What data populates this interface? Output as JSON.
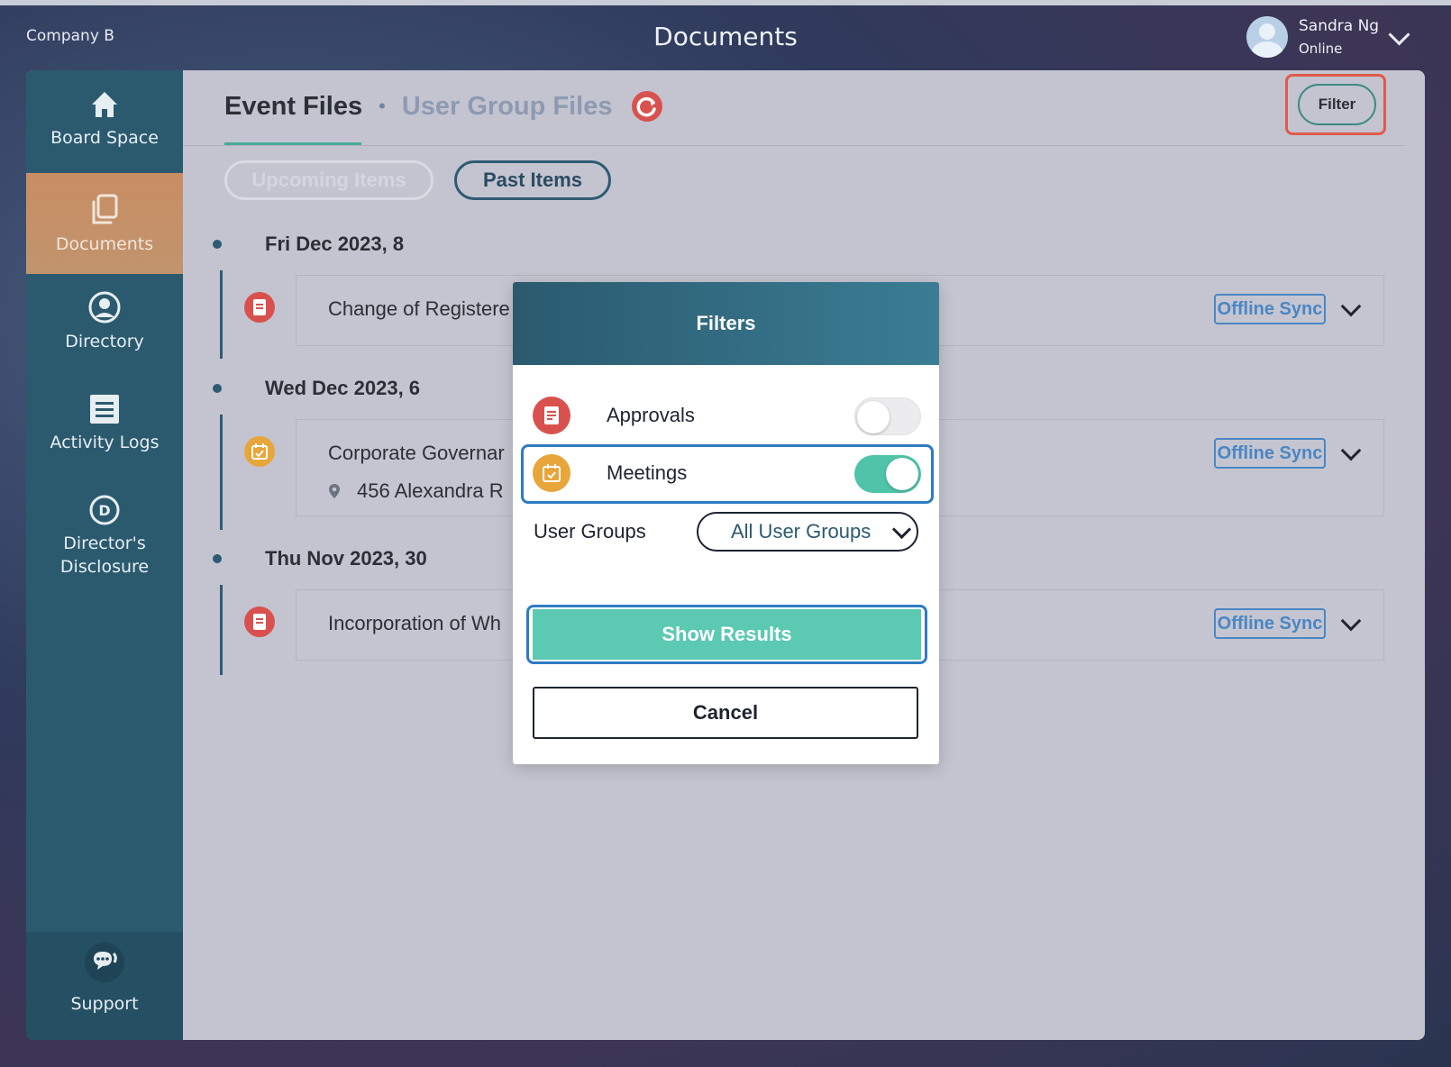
{
  "header": {
    "company": "Company B",
    "title": "Documents",
    "user_name": "Sandra Ng",
    "user_status": "Online"
  },
  "sidebar": {
    "items": [
      {
        "label": "Board Space",
        "icon": "home-icon"
      },
      {
        "label": "Documents",
        "icon": "documents-icon",
        "active": true
      },
      {
        "label": "Directory",
        "icon": "user-circle-icon"
      },
      {
        "label": "Activity Logs",
        "icon": "list-icon"
      },
      {
        "label": "Director's",
        "label2": "Disclosure",
        "icon": "d-circle-icon"
      }
    ],
    "support_label": "Support"
  },
  "tabs": {
    "active": "Event Files",
    "separator": "•",
    "inactive": "User Group Files"
  },
  "toolbar": {
    "filter_label": "Filter",
    "upcoming_label": "Upcoming Items",
    "past_label": "Past Items"
  },
  "events": [
    {
      "date": "Fri Dec 2023, 8",
      "title": "Change of Registere",
      "location": "",
      "type": "approval",
      "sync_label": "Offline Sync"
    },
    {
      "date": "Wed Dec 2023, 6",
      "title": "Corporate Governar",
      "location": "456 Alexandra R",
      "type": "meeting",
      "sync_label": "Offline Sync"
    },
    {
      "date": "Thu Nov 2023, 30",
      "title": "Incorporation of Wh",
      "location": "",
      "type": "approval",
      "sync_label": "Offline Sync"
    }
  ],
  "modal": {
    "title": "Filters",
    "approvals_label": "Approvals",
    "approvals_on": false,
    "meetings_label": "Meetings",
    "meetings_on": true,
    "user_groups_label": "User Groups",
    "user_groups_value": "All User Groups",
    "show_results_label": "Show Results",
    "cancel_label": "Cancel"
  },
  "colors": {
    "sidebar": "#2b5a6f",
    "active_nav": "#c98d64",
    "accent_teal": "#5cc9b2",
    "approval_red": "#d9514e",
    "meeting_orange": "#e8a53a",
    "sync_blue": "#4a86c4",
    "highlight_red": "#e05a4a",
    "highlight_blue": "#2f7bc4"
  }
}
